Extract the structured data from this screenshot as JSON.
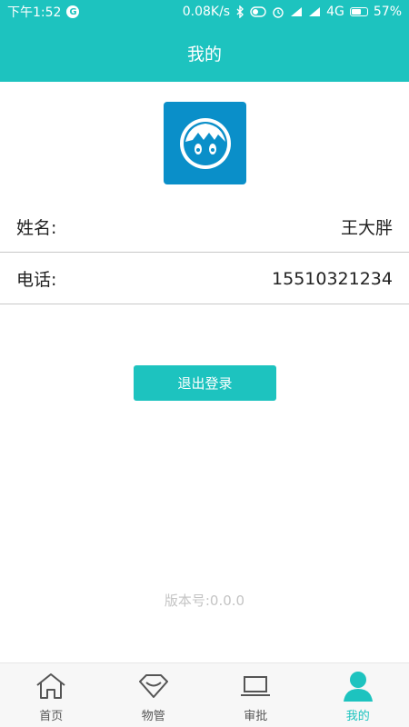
{
  "status_bar": {
    "time": "下午1:52",
    "speed": "0.08K/s",
    "network": "4G",
    "battery": "57%"
  },
  "header": {
    "title": "我的"
  },
  "profile": {
    "name_label": "姓名:",
    "name_value": "王大胖",
    "phone_label": "电话:",
    "phone_value": "15510321234"
  },
  "actions": {
    "logout_label": "退出登录"
  },
  "footer": {
    "version": "版本号:0.0.0"
  },
  "colors": {
    "accent": "#1dc3bf",
    "avatar_bg": "#0a8fc9"
  },
  "bottom_nav": {
    "items": [
      {
        "label": "首页",
        "icon": "home-icon"
      },
      {
        "label": "物管",
        "icon": "gem-icon"
      },
      {
        "label": "审批",
        "icon": "laptop-icon"
      },
      {
        "label": "我的",
        "icon": "user-icon",
        "active": true
      }
    ]
  }
}
